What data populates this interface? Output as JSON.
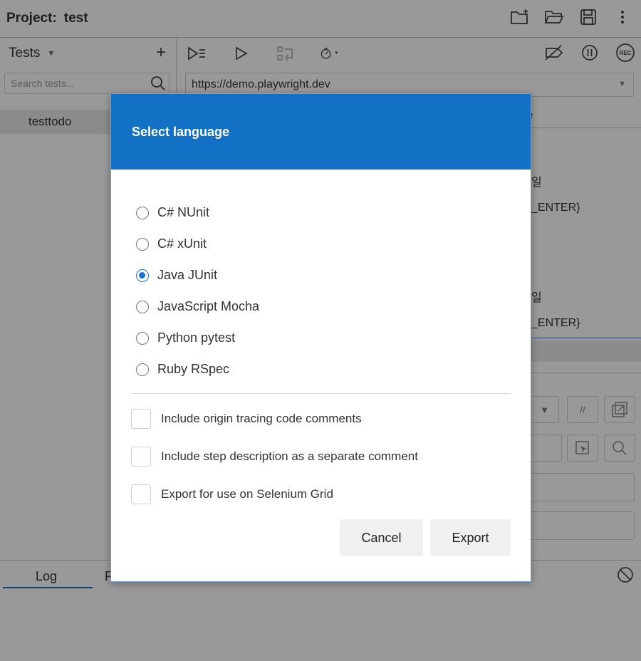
{
  "topbar": {
    "project_label": "Project:",
    "project_name": "test",
    "icons": [
      "new-folder-icon",
      "open-folder-icon",
      "save-icon",
      "more-vertical-icon"
    ]
  },
  "tests_panel": {
    "title": "Tests",
    "search_placeholder": "Search tests...",
    "items": [
      {
        "label": "testtodo"
      }
    ]
  },
  "toolbar": {
    "icons": [
      "run-all-icon",
      "run-icon",
      "step-icon",
      "timer-icon",
      "disable-breakpoints-icon",
      "pause-icon",
      "record-icon"
    ],
    "record_label": "REC"
  },
  "url_bar": {
    "value": "https://demo.playwright.dev"
  },
  "background_fragments": {
    "tab_fragment": "e",
    "row1": "일",
    "row2": "_ENTER}",
    "row3": "일",
    "row4": "_ENTER}",
    "target_btn": "//"
  },
  "bottom_tabs": {
    "log": "Log",
    "second_partial": "R"
  },
  "dialog": {
    "title": "Select language",
    "languages": [
      {
        "label": "C# NUnit",
        "checked": false
      },
      {
        "label": "C# xUnit",
        "checked": false
      },
      {
        "label": "Java JUnit",
        "checked": true
      },
      {
        "label": "JavaScript Mocha",
        "checked": false
      },
      {
        "label": "Python pytest",
        "checked": false
      },
      {
        "label": "Ruby RSpec",
        "checked": false
      }
    ],
    "options": [
      {
        "label": "Include origin tracing code comments",
        "checked": false
      },
      {
        "label": "Include step description as a separate comment",
        "checked": false
      },
      {
        "label": "Export for use on Selenium Grid",
        "checked": false
      }
    ],
    "cancel_label": "Cancel",
    "export_label": "Export"
  },
  "colors": {
    "dialog_header": "#1270c5",
    "radio_selected": "#1a73d1",
    "tab_underline": "#1a6cc2"
  }
}
